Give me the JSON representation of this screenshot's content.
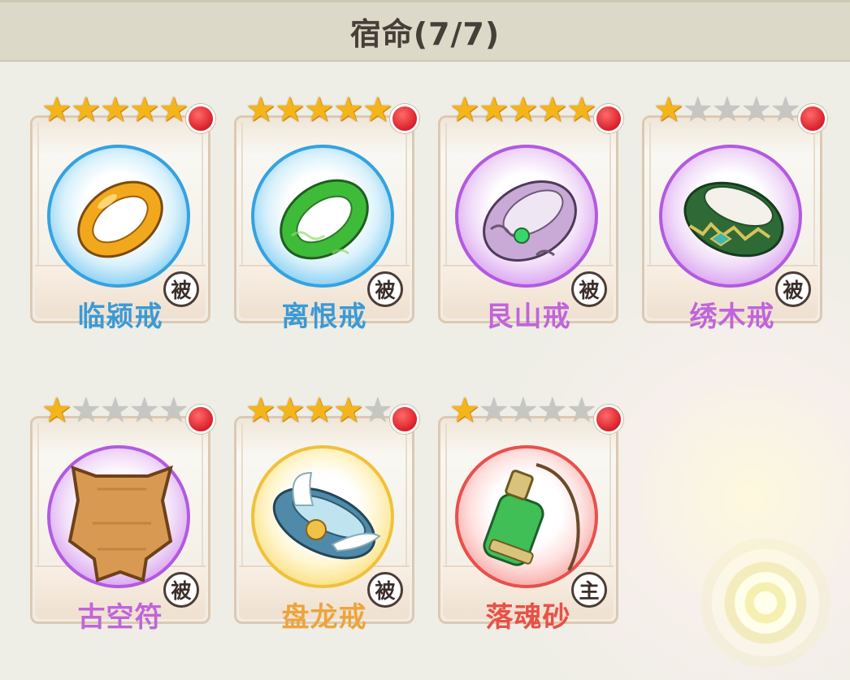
{
  "header": {
    "title": "宿命(7/7)"
  },
  "cards": [
    {
      "name": "临颍戒",
      "stars": 5,
      "badge": "被",
      "rarity": "blue",
      "name_color": "#3a9ad6",
      "icon": "gold-ring-icon"
    },
    {
      "name": "离恨戒",
      "stars": 5,
      "badge": "被",
      "rarity": "blue",
      "name_color": "#3a9ad6",
      "icon": "jade-ring-icon"
    },
    {
      "name": "艮山戒",
      "stars": 5,
      "badge": "被",
      "rarity": "purple",
      "name_color": "#c064dc",
      "icon": "silver-ring-icon"
    },
    {
      "name": "绣木戒",
      "stars": 1,
      "badge": "被",
      "rarity": "purple",
      "name_color": "#c064dc",
      "icon": "embroidered-ring-icon"
    },
    {
      "name": "古空符",
      "stars": 1,
      "badge": "被",
      "rarity": "purple",
      "name_color": "#c064dc",
      "icon": "bronze-plate-icon"
    },
    {
      "name": "盘龙戒",
      "stars": 4,
      "badge": "被",
      "rarity": "gold",
      "name_color": "#eda43c",
      "icon": "winged-headband-icon"
    },
    {
      "name": "落魂砂",
      "stars": 1,
      "badge": "主",
      "rarity": "red",
      "name_color": "#e85048",
      "icon": "green-flask-icon"
    }
  ]
}
